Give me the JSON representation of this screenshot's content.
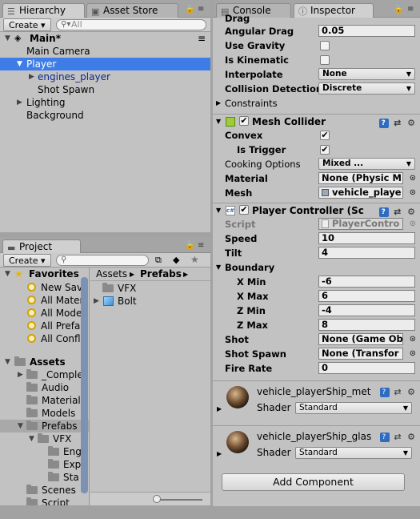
{
  "hierarchy": {
    "tab": "Hierarchy",
    "other_tab": "Asset Store",
    "create": "Create",
    "search_placeholder": "All",
    "scene": "Main*",
    "items": [
      "Main Camera",
      "Player",
      "engines_player",
      "Shot Spawn",
      "Lighting",
      "Background"
    ]
  },
  "project": {
    "tab": "Project",
    "create": "Create",
    "favorites_label": "Favorites",
    "favorites": [
      "New Sav",
      "All Mater",
      "All Mode",
      "All Prefa",
      "All Confl"
    ],
    "assets_label": "Assets",
    "assets": [
      "_Comple",
      "Audio",
      "Materials",
      "Models",
      "Prefabs",
      "VFX",
      "Eng",
      "Exp",
      "Sta",
      "Scenes",
      "Script"
    ],
    "breadcrumb": [
      "Assets",
      "Prefabs"
    ],
    "files": [
      "VFX",
      "Bolt"
    ]
  },
  "inspector": {
    "tabs": [
      "Console",
      "Inspector"
    ],
    "rigidbody": {
      "drag_cut": "Drag",
      "angular_drag_label": "Angular Drag",
      "angular_drag": "0.05",
      "use_gravity": "Use Gravity",
      "is_kinematic": "Is Kinematic",
      "interpolate_label": "Interpolate",
      "interpolate": "None",
      "collision_label": "Collision Detection",
      "collision": "Discrete",
      "constraints": "Constraints"
    },
    "mesh_collider": {
      "title": "Mesh Collider",
      "convex": "Convex",
      "is_trigger": "Is Trigger",
      "cooking_label": "Cooking Options",
      "cooking": "Mixed ...",
      "material_label": "Material",
      "material": "None (Physic M",
      "mesh_label": "Mesh",
      "mesh": "vehicle_playe"
    },
    "player_controller": {
      "title": "Player Controller (Sc",
      "script_label": "Script",
      "script": "PlayerContro",
      "speed_label": "Speed",
      "speed": "10",
      "tilt_label": "Tilt",
      "tilt": "4",
      "boundary_label": "Boundary",
      "xmin_label": "X Min",
      "xmin": "-6",
      "xmax_label": "X Max",
      "xmax": "6",
      "zmin_label": "Z Min",
      "zmin": "-4",
      "zmax_label": "Z Max",
      "zmax": "8",
      "shot_label": "Shot",
      "shot": "None (Game Ob",
      "shotspawn_label": "Shot Spawn",
      "shotspawn": "None (Transfor",
      "firerate_label": "Fire Rate",
      "firerate": "0"
    },
    "materials": [
      {
        "name": "vehicle_playerShip_met",
        "shader_label": "Shader",
        "shader": "Standard"
      },
      {
        "name": "vehicle_playerShip_glas",
        "shader_label": "Shader",
        "shader": "Standard"
      }
    ],
    "add_component": "Add Component"
  }
}
